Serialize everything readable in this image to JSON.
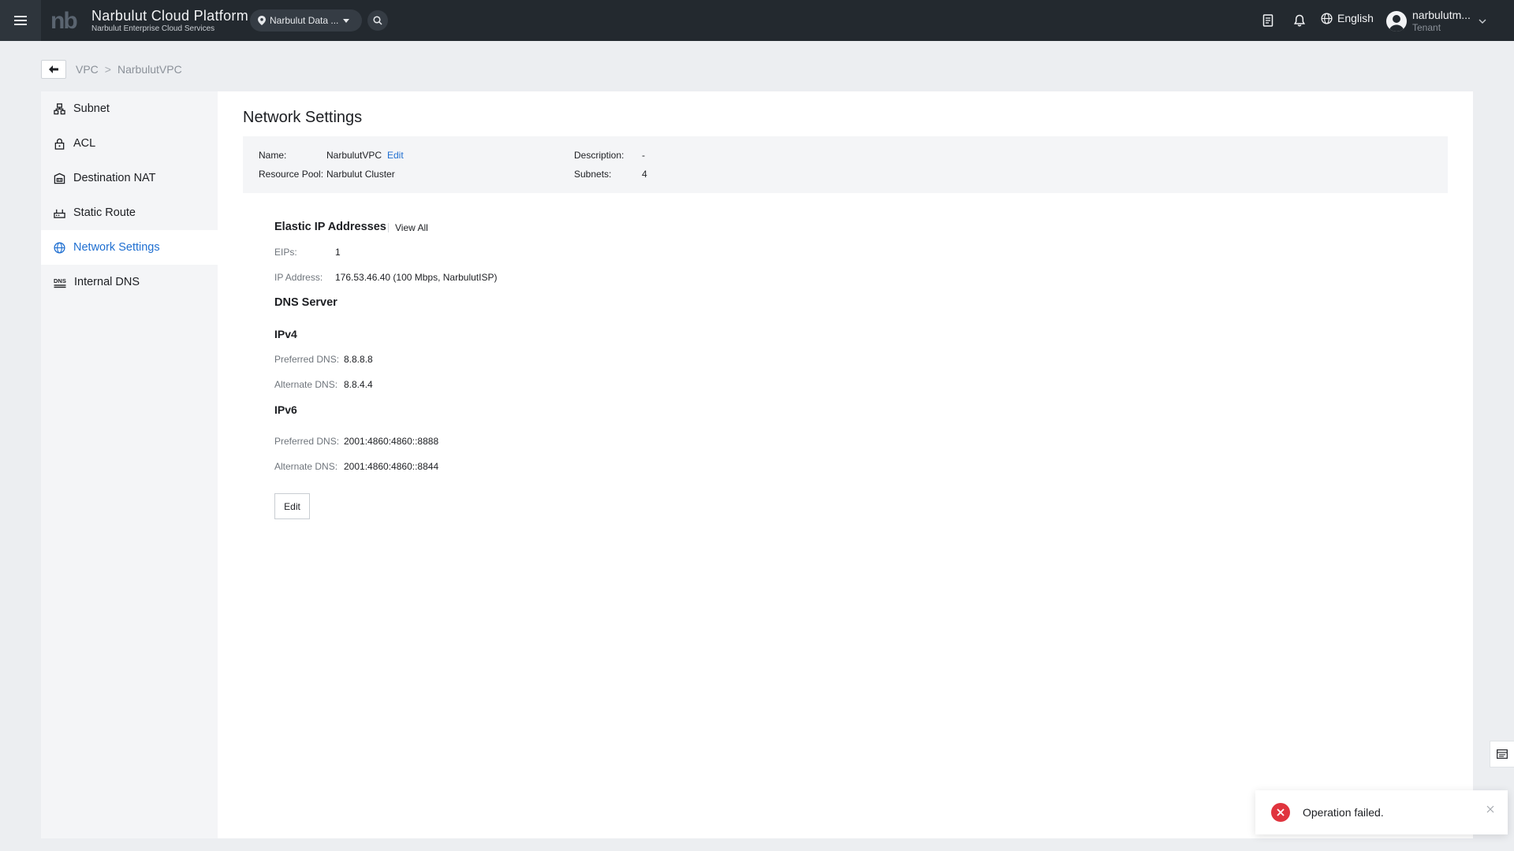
{
  "app": {
    "title": "Narbulut Cloud Platform",
    "subtitle": "Narbulut Enterprise Cloud Services",
    "logo_text": "nb"
  },
  "header": {
    "region": "Narbulut Data ...",
    "language": "English",
    "user": {
      "name": "narbulutm...",
      "role": "Tenant"
    },
    "icons": [
      "menu-icon",
      "location-pin-icon",
      "chevron-down-icon",
      "search-icon",
      "document-icon",
      "bell-icon",
      "globe-icon",
      "user-avatar-icon"
    ]
  },
  "breadcrumb": {
    "items": [
      "VPC",
      "NarbulutVPC"
    ],
    "separator": ">"
  },
  "sidebar": {
    "items": [
      {
        "label": "Subnet",
        "icon": "subnet-icon"
      },
      {
        "label": "ACL",
        "icon": "lock-icon"
      },
      {
        "label": "Destination NAT",
        "icon": "nat-icon"
      },
      {
        "label": "Static Route",
        "icon": "router-icon"
      },
      {
        "label": "Network Settings",
        "icon": "globe-icon",
        "active": true
      },
      {
        "label": "Internal DNS",
        "icon": "dns-icon"
      }
    ]
  },
  "main": {
    "title": "Network Settings",
    "info": {
      "name_label": "Name:",
      "name_value": "NarbulutVPC",
      "name_edit": "Edit",
      "pool_label": "Resource Pool:",
      "pool_value": "Narbulut Cluster",
      "desc_label": "Description:",
      "desc_value": "-",
      "subnets_label": "Subnets:",
      "subnets_value": "4"
    },
    "eip": {
      "title": "Elastic IP Addresses",
      "view_all": "View All",
      "eips_label": "EIPs:",
      "eips_value": "1",
      "ip_label": "IP Address:",
      "ip_value": "176.53.46.40 (100 Mbps, NarbulutISP)"
    },
    "dns": {
      "title": "DNS Server",
      "ipv4": {
        "title": "IPv4",
        "preferred_label": "Preferred DNS:",
        "preferred_value": "8.8.8.8",
        "alternate_label": "Alternate DNS:",
        "alternate_value": "8.8.4.4"
      },
      "ipv6": {
        "title": "IPv6",
        "preferred_label": "Preferred DNS:",
        "preferred_value": "2001:4860:4860::8888",
        "alternate_label": "Alternate DNS:",
        "alternate_value": "2001:4860:4860::8844"
      }
    },
    "edit_button": "Edit"
  },
  "toast": {
    "message": "Operation failed.",
    "type": "error"
  },
  "colors": {
    "topbar": "#23292f",
    "accent": "#1f6fd1",
    "error": "#e0343e",
    "page_bg": "#eceef1"
  }
}
